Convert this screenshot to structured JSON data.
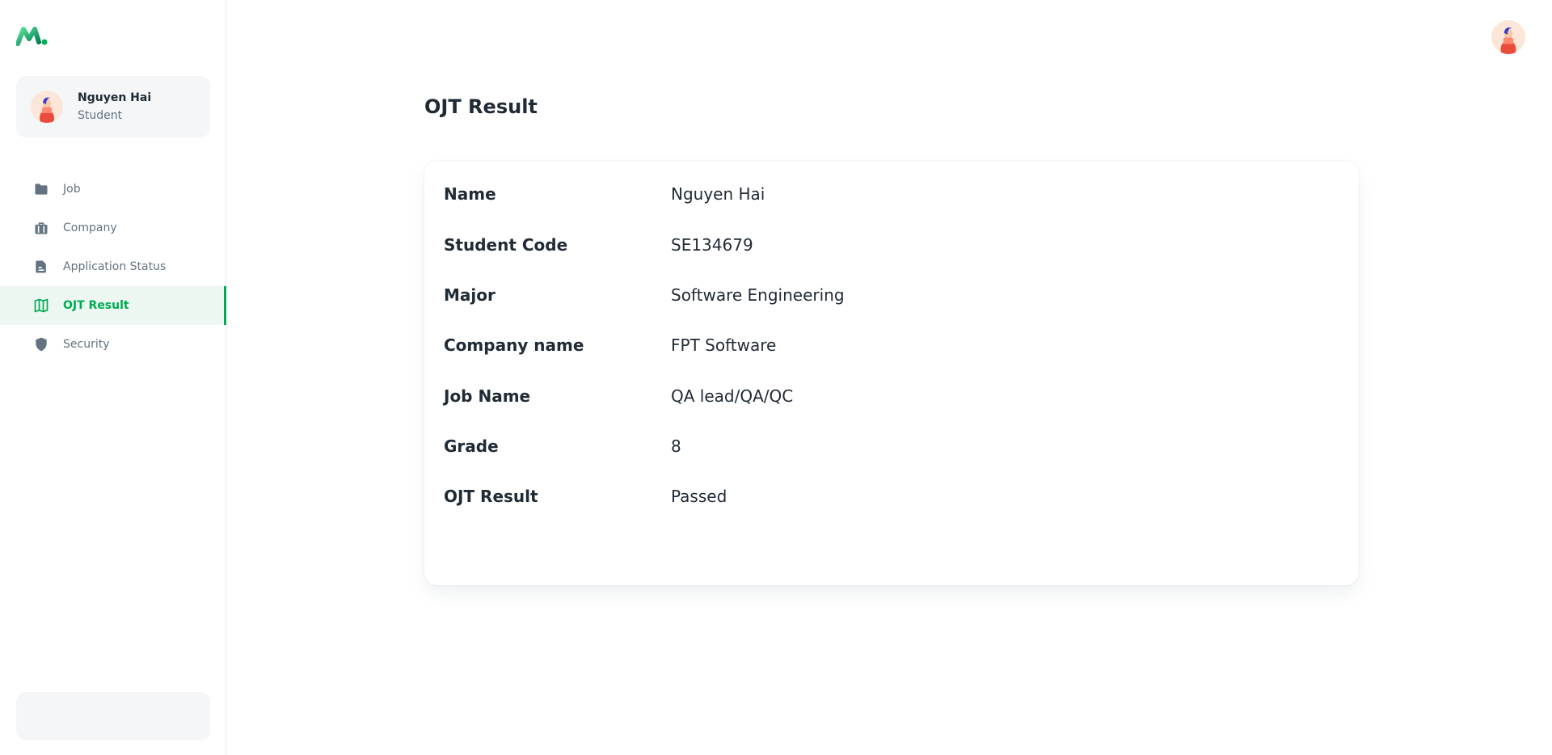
{
  "account": {
    "name": "Nguyen Hai",
    "role": "Student"
  },
  "nav": {
    "items": [
      {
        "label": "Job",
        "icon": "folder-icon"
      },
      {
        "label": "Company",
        "icon": "briefcase-icon"
      },
      {
        "label": "Application Status",
        "icon": "document-icon"
      },
      {
        "label": "OJT Result",
        "icon": "map-icon",
        "active": true
      },
      {
        "label": "Security",
        "icon": "shield-icon"
      }
    ]
  },
  "page": {
    "title": "OJT Result"
  },
  "result": {
    "rows": [
      {
        "label": "Name",
        "value": "Nguyen Hai"
      },
      {
        "label": "Student Code",
        "value": "SE134679"
      },
      {
        "label": "Major",
        "value": "Software Engineering"
      },
      {
        "label": "Company name",
        "value": "FPT Software"
      },
      {
        "label": "Job Name",
        "value": "QA lead/QA/QC"
      },
      {
        "label": "Grade",
        "value": "8"
      },
      {
        "label": "OJT Result",
        "value": "Passed"
      }
    ]
  },
  "colors": {
    "accent": "#00ab55",
    "accent_bg": "#ebf7f0",
    "text": "#212b36",
    "muted": "#637381",
    "panel": "#f4f6f8"
  }
}
